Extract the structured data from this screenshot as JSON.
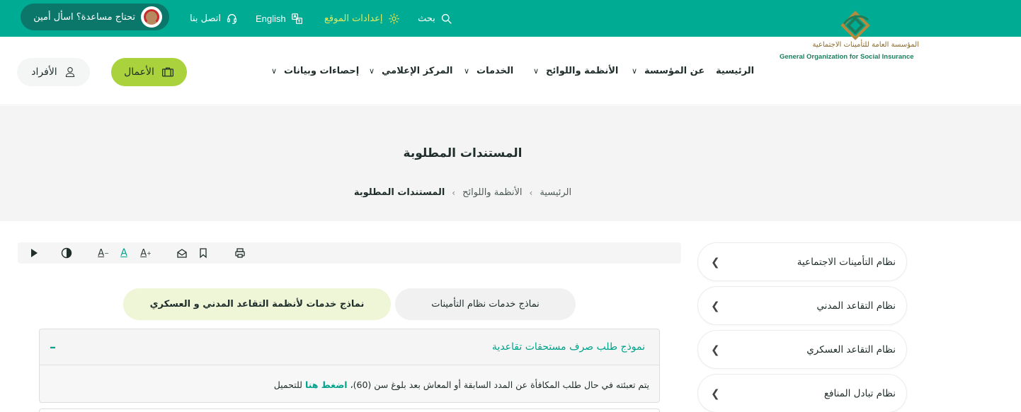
{
  "topbar": {
    "help": "تحتاج مساعدة؟ اسأل أمين",
    "contact": "اتصل بنا",
    "language": "English",
    "settings": "إعدادات الموقع",
    "search": "بحث"
  },
  "header": {
    "individuals": "الأفراد",
    "business": "الأعمال",
    "nav": [
      {
        "label": "الرئيسية"
      },
      {
        "label": "عن المؤسسة"
      },
      {
        "label": "الأنظمة واللوائح"
      },
      {
        "label": "الخدمات"
      },
      {
        "label": "المركز الإعلامي"
      },
      {
        "label": "إحصاءات وبيانات"
      }
    ],
    "logo_ar": "المؤسسة العامة للتأمينات الاجتماعية",
    "logo_en": "General Organization for Social Insurance"
  },
  "hero": {
    "title": "المستندات المطلوبة",
    "breadcrumb": [
      "الرئيسية",
      "الأنظمة واللوائح",
      "المستندات المطلوبة"
    ]
  },
  "a11y": {
    "font_small": "A",
    "font_normal": "A",
    "font_large": "A"
  },
  "sidebar": {
    "items": [
      {
        "label": "نظام التأمينات الاجتماعية"
      },
      {
        "label": "نظام التقاعد المدني"
      },
      {
        "label": "نظام التقاعد العسكري"
      },
      {
        "label": "نظام تبادل المنافع"
      }
    ]
  },
  "tabs": {
    "insurance": "نماذج خدمات نظام التأمينات",
    "civil_military": "نماذج خدمات لأنظمة التقاعد المدني و العسكري"
  },
  "accordion": {
    "title": "نموذج طلب صرف مستحقات تقاعدية",
    "collapse_symbol": "–",
    "body_text": "يتم تعبئته في حال طلب المكافأة عن المدد السابقة أو المعاش بعد بلوغ سن (60)،",
    "link_text": "اضغط هنا",
    "body_suffix": "للتحميل"
  },
  "colors": {
    "primary": "#00ab94",
    "primary_dark": "#0b776a",
    "accent_green": "#a9d23c",
    "settings_yellow": "#e3ea5a"
  }
}
